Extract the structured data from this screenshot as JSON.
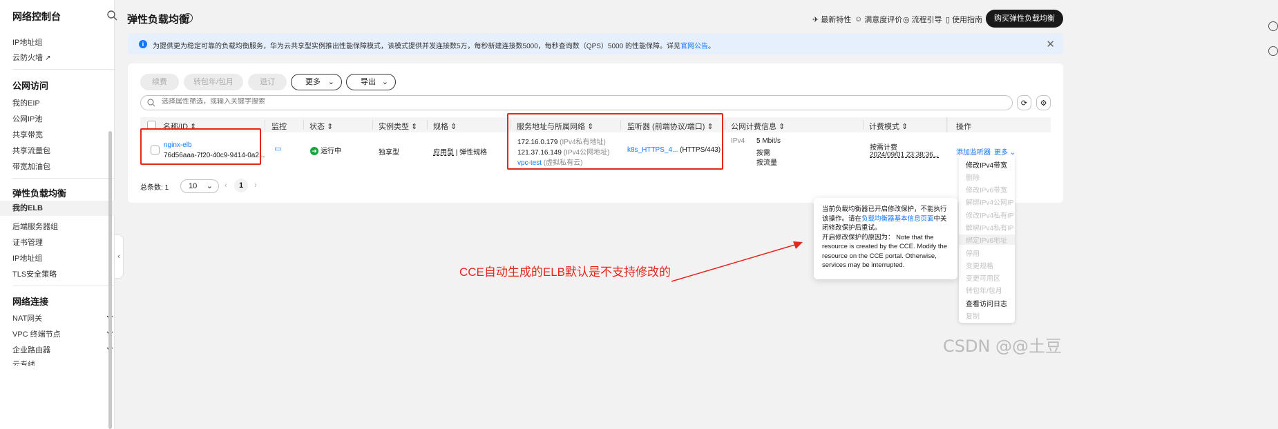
{
  "sidebar": {
    "title": "网络控制台",
    "items_top": [
      "IP地址组",
      "云防火墙"
    ],
    "group_public": "公网访问",
    "public_items": [
      "我的EIP",
      "公网IP池",
      "共享带宽",
      "共享流量包",
      "带宽加油包"
    ],
    "group_elb": "弹性负载均衡",
    "elb_items": [
      "我的ELB",
      "后端服务器组",
      "证书管理",
      "IP地址组",
      "TLS安全策略"
    ],
    "group_conn": "网络连接",
    "conn_items": [
      "NAT网关",
      "VPC 终端节点",
      "企业路由器",
      "云专线"
    ]
  },
  "header": {
    "title": "弹性负载均衡",
    "links": [
      "最新特性",
      "满意度评价",
      "流程引导",
      "使用指南"
    ],
    "buy_button": "购买弹性负载均衡"
  },
  "notice": {
    "text": "为提供更为稳定可靠的负载均衡服务，华为云共享型实例推出性能保障模式，该模式提供并发连接数5万，每秒新建连接数5000，每秒查询数（QPS）5000 的性能保障。详见",
    "link": "官网公告",
    "suffix": "。"
  },
  "toolbar": {
    "renew": "续费",
    "to_yearly": "转包年/包月",
    "unsubscribe": "退订",
    "more": "更多",
    "export": "导出",
    "search_placeholder": "选择属性筛选，或输入关键字搜索"
  },
  "table": {
    "headers": [
      "名称/ID",
      "监控",
      "状态",
      "实例类型",
      "规格",
      "服务地址与所属网络",
      "监听器 (前端协议/端口)",
      "公网计费信息",
      "计费模式",
      "操作"
    ],
    "row": {
      "name": "nginx-elb",
      "id": "76d56aaa-7f20-40c9-9414-0a2...",
      "status": "运行中",
      "instance_type": "独享型",
      "spec_app": "应用型",
      "spec_elastic": "弹性规格",
      "ip_private": "172.16.0.179",
      "ip_private_label": "(IPv4私有地址)",
      "ip_public": "121.37.16.149",
      "ip_public_label": "(IPv4公网地址)",
      "vpc": "vpc-test",
      "vpc_label": "(虚拟私有云)",
      "listener": "k8s_HTTPS_4...",
      "listener_proto": "(HTTPS/443)",
      "ipver": "IPv4",
      "bandwidth": "5 Mbit/s",
      "billing_demand": "按需",
      "billing_traffic": "按流量",
      "billing_mode": "按需计费",
      "billing_time": "2024/09/01 23:38:36...",
      "op_add_listener": "添加监听器",
      "op_more": "更多"
    }
  },
  "pager": {
    "total_label": "总条数:",
    "total": "1",
    "page_size": "10",
    "page": "1"
  },
  "dropdown": {
    "items": [
      {
        "label": "修改IPv4带宽",
        "disabled": false
      },
      {
        "label": "删除",
        "disabled": true
      },
      {
        "label": "修改IPv6带宽",
        "disabled": true
      },
      {
        "label": "解绑IPv4公网IP",
        "disabled": true
      },
      {
        "label": "修改IPv4私有IP",
        "disabled": true
      },
      {
        "label": "解绑IPv4私有IP",
        "disabled": true
      },
      {
        "label": "绑定IPv6地址",
        "disabled": true
      },
      {
        "label": "停用",
        "disabled": true
      },
      {
        "label": "变更规格",
        "disabled": true
      },
      {
        "label": "变更可用区",
        "disabled": true
      },
      {
        "label": "转包年/包月",
        "disabled": true
      },
      {
        "label": "查看访问日志",
        "disabled": false
      },
      {
        "label": "复制",
        "disabled": true
      }
    ]
  },
  "tooltip": {
    "line1": "当前负载均衡器已开启修改保护，不能执行该操作。请在",
    "link": "负载均衡器基本信息页面",
    "line1b": "中关闭修改保护后重试。",
    "line2": "开启修改保护的原因为： Note that the resource is created by the CCE. Modify the resource on the CCE portal. Otherwise, services may be interrupted."
  },
  "annotation": "CCE自动生成的ELB默认是不支持修改的",
  "watermark": "CSDN @@土豆",
  "colors": {
    "accent": "#1476ff",
    "red": "#e5261b",
    "running": "#12a83b"
  }
}
